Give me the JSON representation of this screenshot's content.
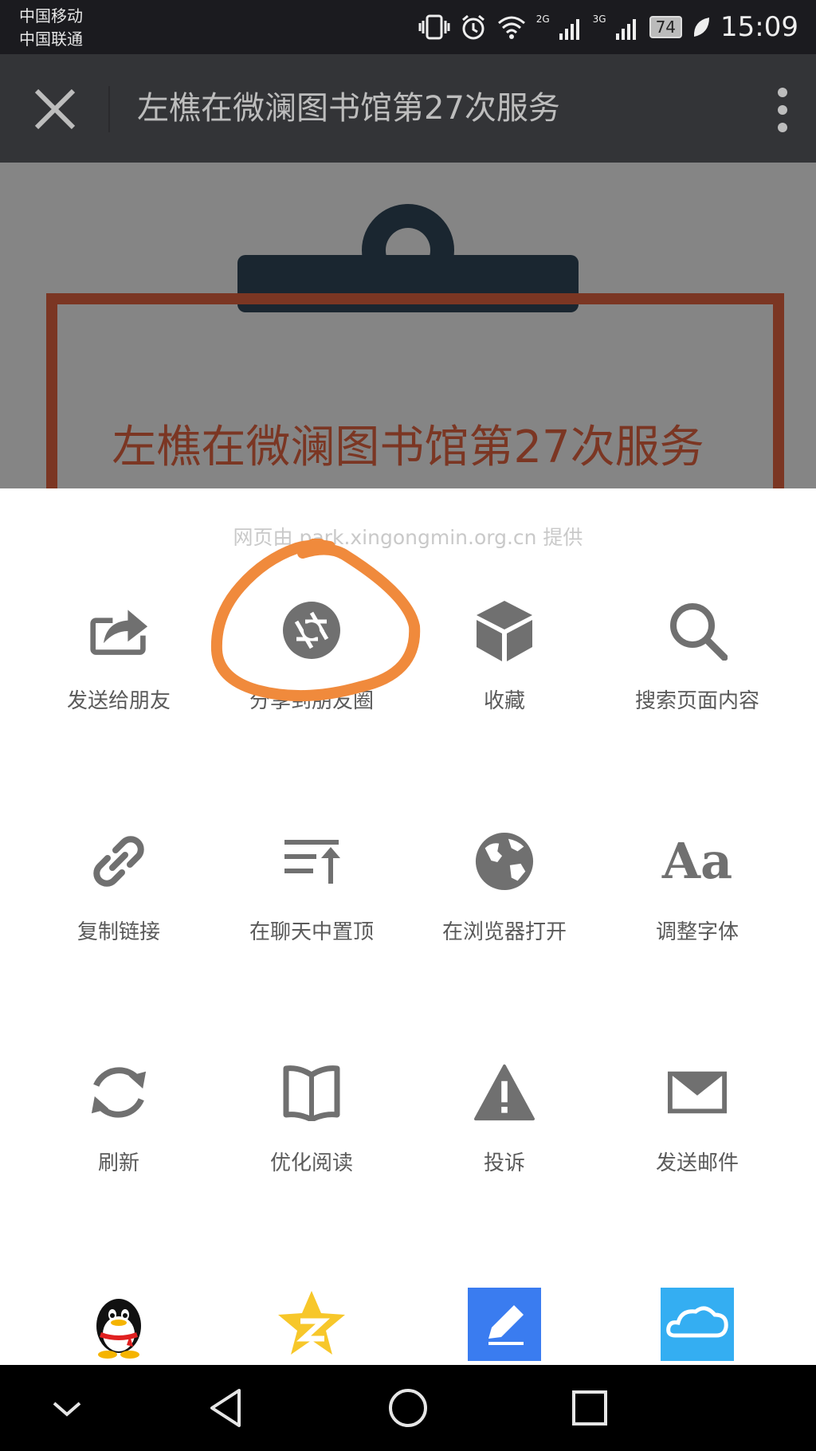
{
  "status_bar": {
    "carrier_1": "中国移动",
    "carrier_2": "中国联通",
    "net_1": "2G",
    "net_2": "3G",
    "battery": "74",
    "time": "15:09"
  },
  "nav_bar": {
    "title": "左樵在微澜图书馆第27次服务"
  },
  "page": {
    "heading": "左樵在微澜图书馆第27次服务"
  },
  "sheet": {
    "source_note": "网页由 park.xingongmin.org.cn 提供",
    "actions": [
      {
        "label": "发送给朋友",
        "icon": "share-icon"
      },
      {
        "label": "分享到朋友圈",
        "icon": "moments-aperture-icon"
      },
      {
        "label": "收藏",
        "icon": "favorite-cube-icon"
      },
      {
        "label": "搜索页面内容",
        "icon": "search-icon"
      },
      {
        "label": "复制链接",
        "icon": "link-icon"
      },
      {
        "label": "在聊天中置顶",
        "icon": "pin-top-icon"
      },
      {
        "label": "在浏览器打开",
        "icon": "globe-icon"
      },
      {
        "label": "调整字体",
        "icon": "font-size-icon"
      },
      {
        "label": "刷新",
        "icon": "refresh-icon"
      },
      {
        "label": "优化阅读",
        "icon": "book-icon"
      },
      {
        "label": "投诉",
        "icon": "warning-icon"
      },
      {
        "label": "发送邮件",
        "icon": "mail-icon"
      }
    ],
    "apps": [
      {
        "name": "qq-icon"
      },
      {
        "name": "qzone-icon"
      },
      {
        "name": "note-pen-icon"
      },
      {
        "name": "cloud-icon"
      }
    ],
    "font_icon_text": "Aa"
  },
  "colors": {
    "icon_gray": "#707070",
    "label_gray": "#5a5a5a",
    "scribble_orange": "#f08a3c",
    "page_accent": "#7b3623"
  }
}
